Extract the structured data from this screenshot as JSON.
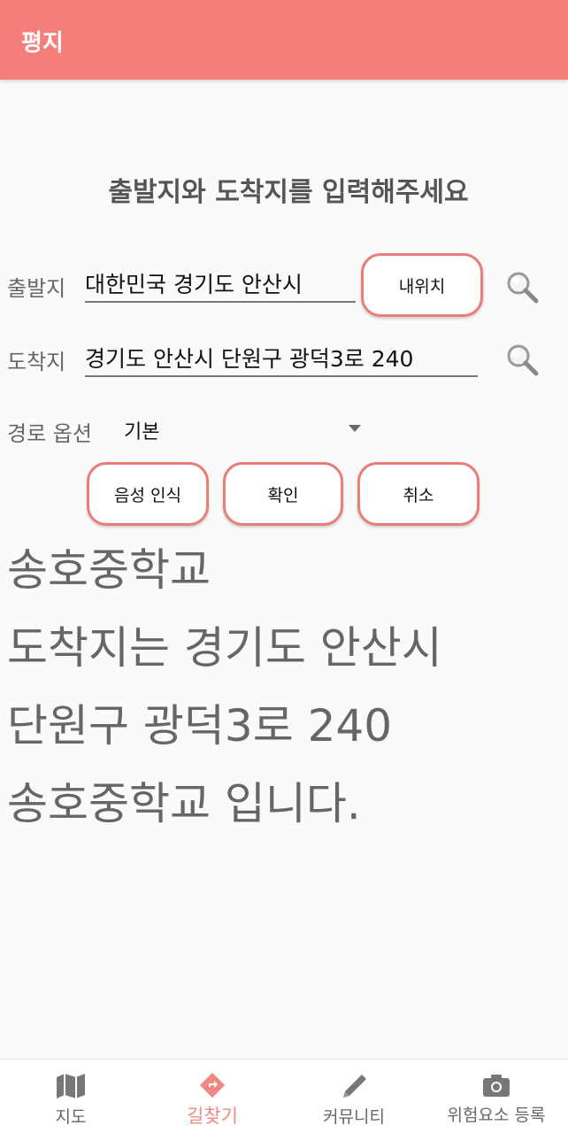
{
  "appbar": {
    "title": "평지"
  },
  "heading": "출발지와 도착지를 입력해주세요",
  "origin": {
    "label": "출발지",
    "value": "대한민국 경기도 안산시",
    "my_location_label": "내위치"
  },
  "destination": {
    "label": "도착지",
    "value": "경기도 안산시 단원구 광덕3로 240"
  },
  "route_option": {
    "label": "경로 옵션",
    "selected": "기본"
  },
  "actions": {
    "voice_label": "음성 인식",
    "confirm_label": "확인",
    "cancel_label": "취소"
  },
  "result": {
    "lines": [
      "송호중학교",
      "도착지는 경기도 안산시",
      "단원구 광덕3로 240",
      "송호중학교 입니다."
    ]
  },
  "bottom_nav": {
    "items": [
      {
        "label": "지도",
        "icon": "map-icon"
      },
      {
        "label": "길찾기",
        "icon": "directions-icon",
        "active": true
      },
      {
        "label": "커뮤니티",
        "icon": "pencil-icon"
      },
      {
        "label": "위험요소 등록",
        "icon": "camera-icon"
      }
    ]
  },
  "colors": {
    "accent": "#f87e7b",
    "pill_border": "#ea7c79",
    "active_nav": "#f08985"
  }
}
